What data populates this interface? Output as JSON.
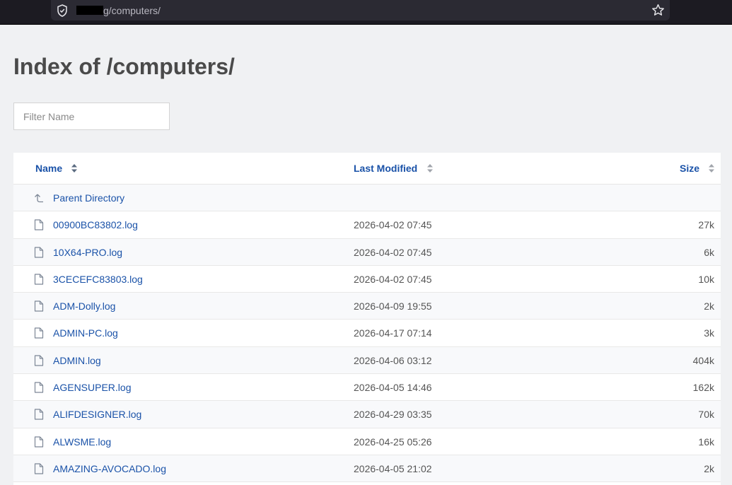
{
  "browser": {
    "url_path": "g/computers/",
    "icons": {
      "security": "shield-check-icon",
      "bookmark": "star-icon"
    }
  },
  "page": {
    "title": "Index of /computers/",
    "filter_placeholder": "Filter Name"
  },
  "table": {
    "columns": {
      "name": "Name",
      "modified": "Last Modified",
      "size": "Size"
    },
    "parent": {
      "label": "Parent Directory",
      "icon": "up-arrow-icon"
    },
    "rows": [
      {
        "name": "00900BC83802.log",
        "modified": "2026-04-02 07:45",
        "size": "27k"
      },
      {
        "name": "10X64-PRO.log",
        "modified": "2026-04-02 07:45",
        "size": "6k"
      },
      {
        "name": "3CECEFC83803.log",
        "modified": "2026-04-02 07:45",
        "size": "10k"
      },
      {
        "name": "ADM-Dolly.log",
        "modified": "2026-04-09 19:55",
        "size": "2k"
      },
      {
        "name": "ADMIN-PC.log",
        "modified": "2026-04-17 07:14",
        "size": "3k"
      },
      {
        "name": "ADMIN.log",
        "modified": "2026-04-06 03:12",
        "size": "404k"
      },
      {
        "name": "AGENSUPER.log",
        "modified": "2026-04-05 14:46",
        "size": "162k"
      },
      {
        "name": "ALIFDESIGNER.log",
        "modified": "2026-04-29 03:35",
        "size": "70k"
      },
      {
        "name": "ALWSME.log",
        "modified": "2026-04-25 05:26",
        "size": "16k"
      },
      {
        "name": "AMAZING-AVOCADO.log",
        "modified": "2026-04-05 21:02",
        "size": "2k"
      }
    ]
  },
  "colors": {
    "link": "#1a52a8",
    "title": "#4a4a4a",
    "background": "#f0f1f3"
  }
}
